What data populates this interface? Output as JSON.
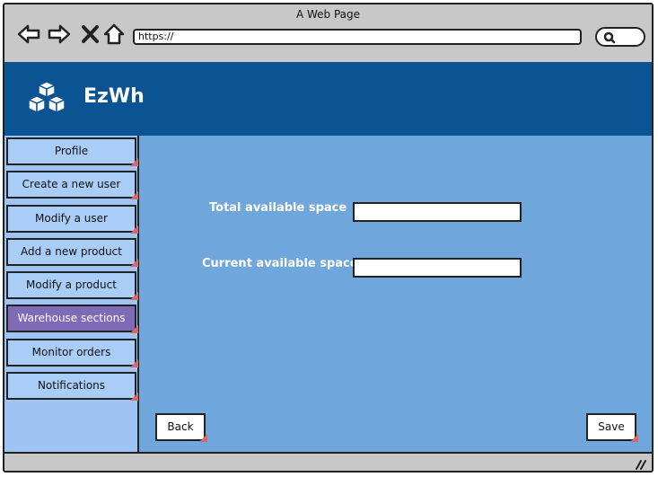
{
  "window": {
    "title": "A Web Page"
  },
  "browser": {
    "url": "https://"
  },
  "app": {
    "brand": "EzWh"
  },
  "sidebar": {
    "items": [
      {
        "label": "Profile"
      },
      {
        "label": "Create a new user"
      },
      {
        "label": "Modify a user"
      },
      {
        "label": "Add a new product"
      },
      {
        "label": "Modify a product"
      },
      {
        "label": "Warehouse sections",
        "active": true
      },
      {
        "label": "Monitor orders"
      },
      {
        "label": "Notifications"
      }
    ]
  },
  "form": {
    "total_label": "Total available space",
    "total_value": "",
    "current_label": "Current available space",
    "current_value": ""
  },
  "buttons": {
    "back": "Back",
    "save": "Save"
  },
  "colors": {
    "header": "#0a5494",
    "sidebar": "#9ec4f4",
    "active": "#7e6bb8",
    "content": "#6fa6dc"
  }
}
